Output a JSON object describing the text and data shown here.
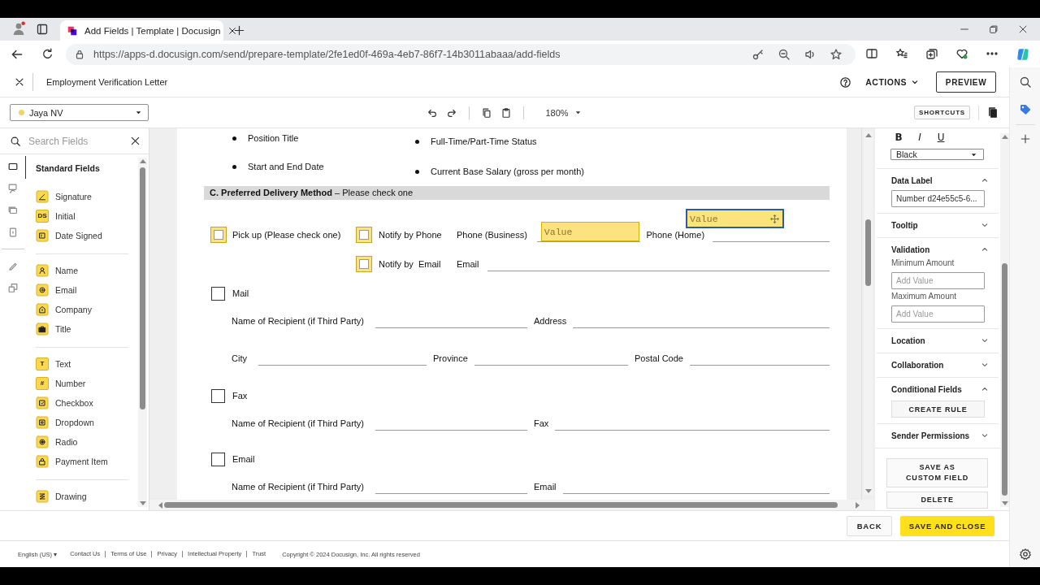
{
  "browser": {
    "tab_title": "Add Fields | Template | Docusign",
    "url": "https://apps-d.docusign.com/send/prepare-template/2fe1ed0f-469a-4eb7-86f7-14b3011abaaa/add-fields"
  },
  "header": {
    "title": "Employment Verification Letter",
    "actions": "ACTIONS",
    "preview": "PREVIEW"
  },
  "toolbar": {
    "recipient": "Jaya NV",
    "zoom": "180%",
    "shortcuts": "SHORTCUTS"
  },
  "fields_panel": {
    "search_placeholder": "Search Fields",
    "rail": [
      {
        "selected": true
      },
      {
        "selected": false
      },
      {
        "selected": false
      },
      {
        "selected": false
      },
      {
        "selected": false
      },
      {
        "selected": false
      }
    ],
    "heading": "Standard Fields",
    "groups": [
      [
        {
          "label": "Signature"
        },
        {
          "label": "Initial",
          "glyph": "DS"
        },
        {
          "label": "Date Signed"
        }
      ],
      [
        {
          "label": "Name"
        },
        {
          "label": "Email"
        },
        {
          "label": "Company"
        },
        {
          "label": "Title"
        }
      ],
      [
        {
          "label": "Text",
          "glyph": "T"
        },
        {
          "label": "Number",
          "glyph": "#"
        },
        {
          "label": "Checkbox"
        },
        {
          "label": "Dropdown"
        },
        {
          "label": "Radio"
        },
        {
          "label": "Payment Item"
        }
      ],
      [
        {
          "label": "Drawing"
        }
      ]
    ]
  },
  "document": {
    "bullets": [
      [
        "Position Title",
        "Start and End Date"
      ],
      [
        "Full-Time/Part-Time Status",
        "Current Base Salary (gross per month)"
      ]
    ],
    "section_heading": "**C. Preferred Delivery Method** – Please check one",
    "pickup": {
      "label": "Pick up (Please check one)",
      "checked": false,
      "kind": "tagged"
    },
    "notify": [
      {
        "label": "Notify by Phone",
        "checked": false,
        "kind": "tagged",
        "fields": [
          {
            "label": "Phone (Business)",
            "placed": {
              "text": "Value",
              "selected": false
            }
          },
          {
            "label": "Phone (Home)",
            "placed": {
              "text": "Value",
              "selected": true
            }
          }
        ]
      },
      {
        "label": "Notify by  Email",
        "checked": false,
        "kind": "tagged",
        "fields": [
          {
            "label": "Email"
          }
        ]
      }
    ],
    "methods": [
      {
        "label": "Mail",
        "checked": false,
        "kind": "plain",
        "rows": [
          [
            "Name of Recipient (if Third Party)",
            "Address"
          ],
          [
            "City",
            "Province",
            "Postal Code"
          ]
        ]
      },
      {
        "label": "Fax",
        "checked": false,
        "kind": "plain",
        "rows": [
          [
            "Name of Recipient (if Third Party)",
            "Fax"
          ]
        ]
      },
      {
        "label": "Email",
        "checked": false,
        "kind": "plain",
        "rows": [
          [
            "Name of Recipient (if Third Party)",
            "Email"
          ]
        ]
      }
    ]
  },
  "properties": {
    "format": [
      {
        "label": "B",
        "kind": "bold"
      },
      {
        "label": "I",
        "kind": "italic"
      },
      {
        "label": "U",
        "kind": "underline"
      }
    ],
    "font_color": "Black",
    "sections": [
      {
        "title": "Data Label",
        "expanded": true,
        "inputs": [
          {
            "value": "Number d24e55c5-6..."
          }
        ]
      },
      {
        "title": "Tooltip",
        "expanded": false
      },
      {
        "title": "Validation",
        "expanded": true,
        "inputs": [
          {
            "label": "Minimum Amount",
            "placeholder": "Add Value"
          },
          {
            "label": "Maximum Amount",
            "placeholder": "Add Value"
          }
        ]
      },
      {
        "title": "Location",
        "expanded": false
      },
      {
        "title": "Collaboration",
        "expanded": false
      },
      {
        "title": "Conditional Fields",
        "expanded": true,
        "button": "CREATE RULE"
      },
      {
        "title": "Sender Permissions",
        "expanded": false
      }
    ],
    "actions": [
      "SAVE AS CUSTOM FIELD",
      "DELETE"
    ]
  },
  "footer": {
    "buttons": [
      {
        "label": "BACK",
        "kind": "secondary"
      },
      {
        "label": "SAVE AND CLOSE",
        "kind": "primary"
      }
    ],
    "language": "English (US) ▾",
    "links": [
      "Contact Us",
      "Terms of Use",
      "Privacy",
      "Intellectual Property",
      "Trust"
    ],
    "copyright": "Copyright © 2024 Docusign, Inc. All rights reserved"
  }
}
